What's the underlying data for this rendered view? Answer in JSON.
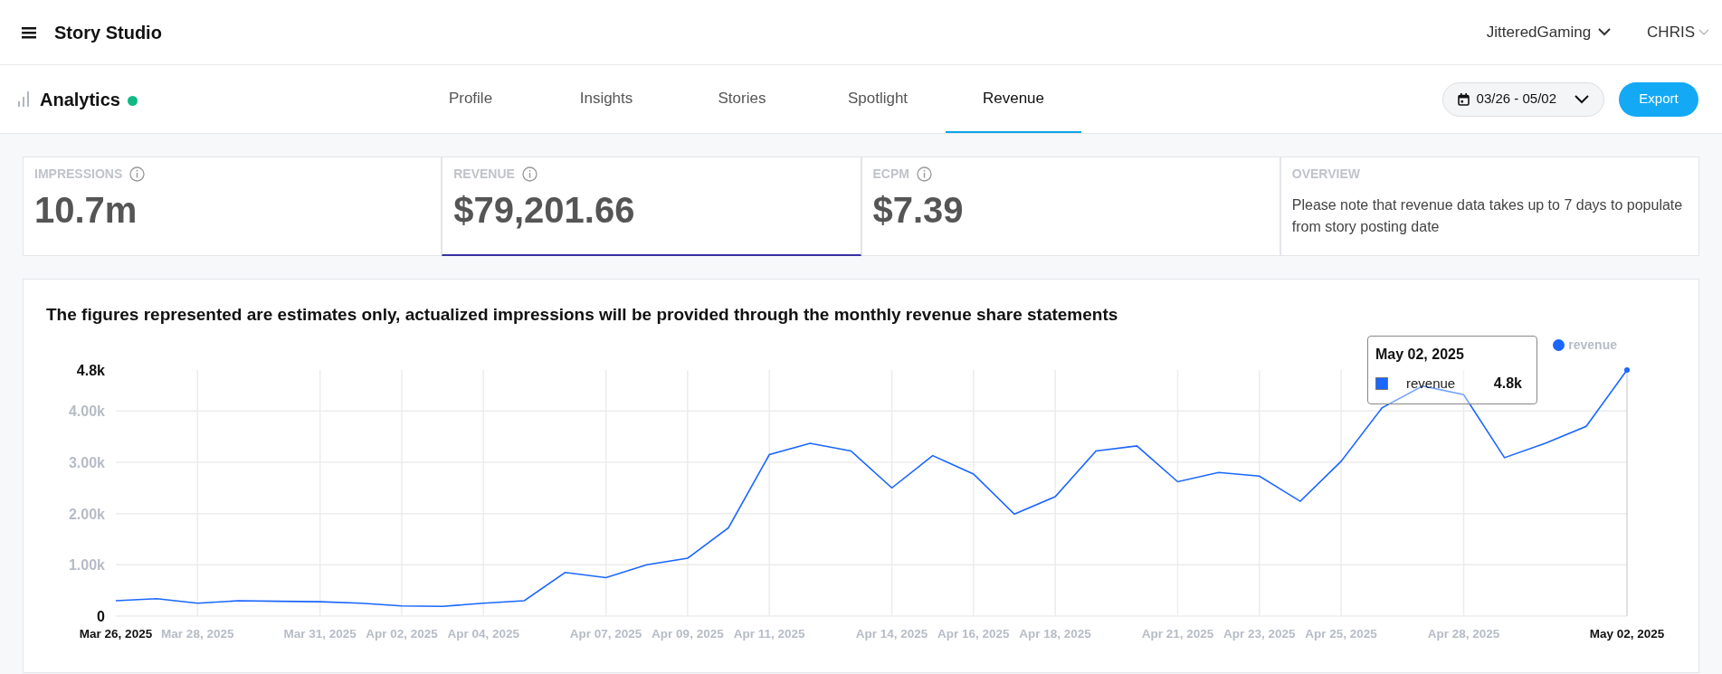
{
  "header": {
    "title": "Story Studio",
    "account": "JitteredGaming",
    "user": "CHRIS"
  },
  "nav": {
    "title": "Analytics",
    "online": true,
    "tabs": [
      {
        "label": "Profile",
        "selected": false
      },
      {
        "label": "Insights",
        "selected": false
      },
      {
        "label": "Stories",
        "selected": false
      },
      {
        "label": "Spotlight",
        "selected": false
      },
      {
        "label": "Revenue",
        "selected": true
      }
    ],
    "date_range": "03/26 - 05/02",
    "export_button": "Export"
  },
  "metrics": [
    {
      "label": "IMPRESSIONS",
      "value": "10.7m",
      "selected": false
    },
    {
      "label": "REVENUE",
      "value": "$79,201.66",
      "selected": true
    },
    {
      "label": "ECPM",
      "value": "$7.39",
      "selected": false
    }
  ],
  "overview": {
    "label": "OVERVIEW",
    "text": "Please note that revenue data takes up to 7 days to populate from story posting date"
  },
  "chart": {
    "chart_data": {
      "type": "line",
      "title": "The figures represented are estimates only, actualized impressions will be provided through the monthly revenue share statements",
      "categories": [
        "Mar 26, 2025",
        null,
        "Mar 28, 2025",
        null,
        null,
        "Mar 31, 2025",
        null,
        "Apr 02, 2025",
        null,
        "Apr 04, 2025",
        null,
        null,
        "Apr 07, 2025",
        null,
        "Apr 09, 2025",
        null,
        "Apr 11, 2025",
        null,
        null,
        "Apr 14, 2025",
        null,
        "Apr 16, 2025",
        null,
        "Apr 18, 2025",
        null,
        null,
        "Apr 21, 2025",
        null,
        "Apr 23, 2025",
        null,
        "Apr 25, 2025",
        null,
        null,
        "Apr 28, 2025",
        null,
        null,
        null,
        "May 02, 2025"
      ],
      "series": [
        {
          "name": "revenue",
          "color": "#1a66ff",
          "values": [
            300,
            340,
            250,
            300,
            290,
            280,
            250,
            200,
            190,
            250,
            300,
            850,
            750,
            1000,
            1130,
            1720,
            3150,
            3370,
            3220,
            2500,
            3130,
            2770,
            1990,
            2330,
            3220,
            3320,
            2620,
            2800,
            2730,
            2240,
            3020,
            4060,
            4490,
            4320,
            3090,
            3370,
            3700,
            4800
          ]
        }
      ],
      "ylim": [
        0,
        4800
      ],
      "grid": true,
      "yticks": [
        {
          "value": 0,
          "label": "0"
        },
        {
          "value": 1000,
          "label": "1.00k"
        },
        {
          "value": 2000,
          "label": "2.00k"
        },
        {
          "value": 3000,
          "label": "3.00k"
        },
        {
          "value": 4000,
          "label": "4.00k"
        },
        {
          "value": 4800,
          "label": "4.8k"
        }
      ]
    },
    "tooltip": {
      "title": "May 02, 2025",
      "series": "revenue",
      "value": "4.8k"
    }
  }
}
